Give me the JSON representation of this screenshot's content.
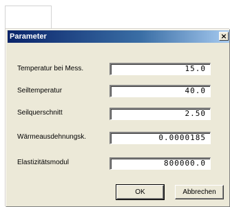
{
  "dialog": {
    "title": "Parameter",
    "close_glyph": "×",
    "close_icon": "close-icon"
  },
  "fields": [
    {
      "label": "Temperatur bei Mess.",
      "value": "15.0"
    },
    {
      "label": "Seiltemperatur",
      "value": "40.0"
    },
    {
      "label": "Seilquerschnitt",
      "value": "2.50"
    },
    {
      "label": "Wärmeausdehnungsk.",
      "value": "0.0000185"
    },
    {
      "label": "Elastizitätsmodul",
      "value": "800000.0"
    }
  ],
  "buttons": {
    "ok_label": "OK",
    "cancel_label": "Abbrechen"
  },
  "colors": {
    "dialog_face": "#ece9d8",
    "title_start": "#0a246a",
    "title_end": "#a6caf0"
  }
}
